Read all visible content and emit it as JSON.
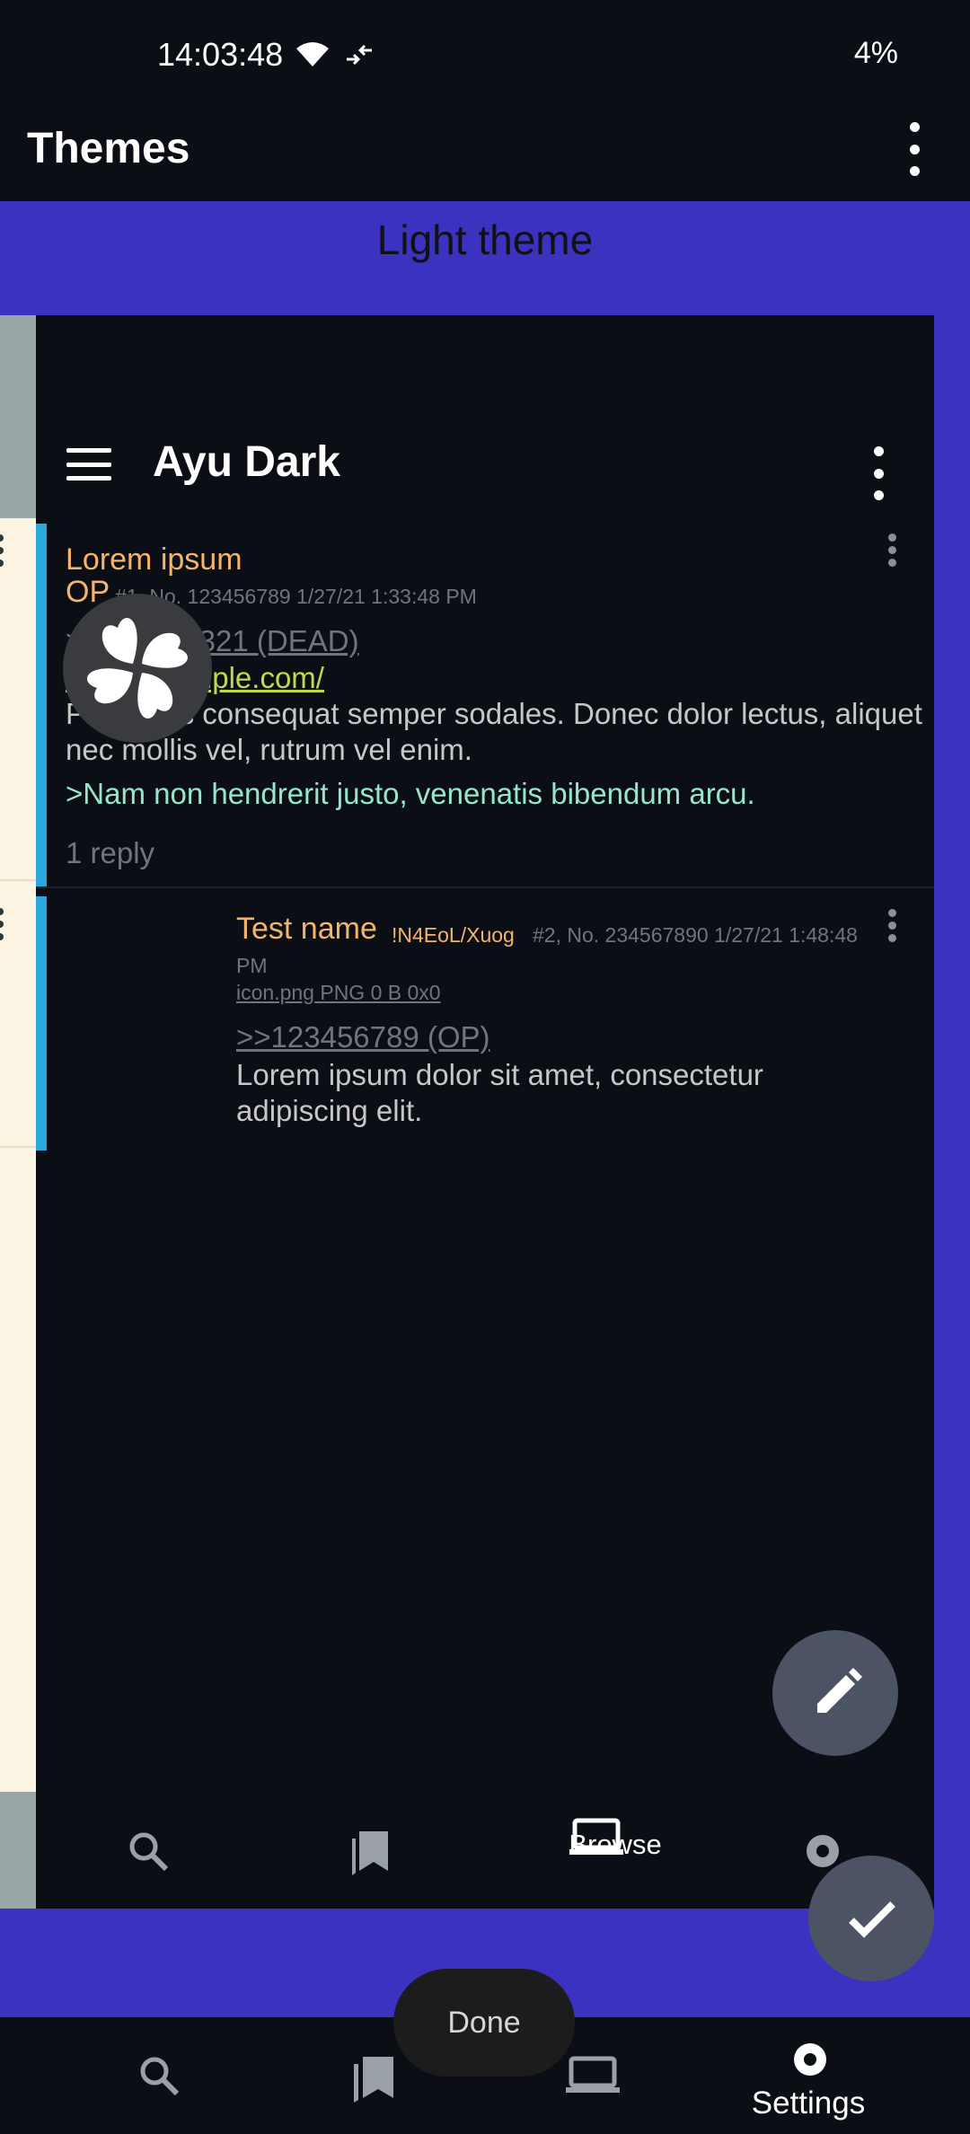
{
  "status_bar": {
    "time": "14:03:48",
    "battery": "4%"
  },
  "app_bar": {
    "title": "Themes"
  },
  "theme_section": {
    "label": "Light theme",
    "background_color": "#3b33c0"
  },
  "preview": {
    "theme_name": "Ayu Dark",
    "posts": [
      {
        "subject": "Lorem ipsum",
        "name": "OP",
        "meta": "#1, No. 123456789 1/27/21 1:33:48 PM",
        "dead_link": ">>987654321 (DEAD)",
        "link": "http://example.com/",
        "body": "Phasellus consequat semper sodales. Donec dolor lectus, aliquet nec mollis vel, rutrum vel enim.",
        "quote": ">Nam non hendrerit justo, venenatis bibendum arcu.",
        "replies": "1 reply"
      },
      {
        "name": "Test name",
        "tripcode": "!N4EoL/Xuog",
        "meta": "#2, No. 234567890 1/27/21 1:48:48",
        "meta_cont": "PM",
        "file": "icon.png PNG 0 B 0x0",
        "op_link": ">>123456789 (OP)",
        "body": "Lorem ipsum dolor sit amet, consectetur adipiscing elit."
      }
    ],
    "nav": {
      "active_label": "Browse"
    }
  },
  "toast": {
    "label": "Done"
  },
  "bottom_nav": {
    "active_label": "Settings"
  },
  "colors": {
    "background": "#0b0e14",
    "accent_blue": "#3b33c0",
    "post_bar": "#2aa8dc",
    "subject": "#f3b56a",
    "link": "#c2d94c",
    "quote": "#95e6cb",
    "fab": "#4b5365"
  }
}
